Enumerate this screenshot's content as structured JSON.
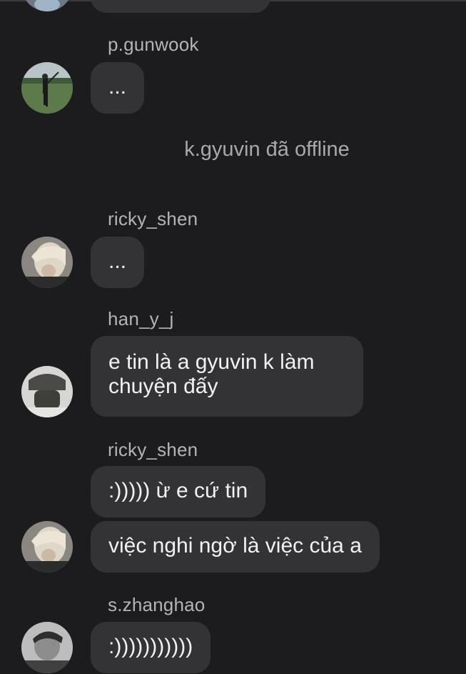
{
  "chat": {
    "system_message": "k.gyuvin đã offline",
    "messages": [
      {
        "id": "top-partial",
        "username": "",
        "text": ""
      },
      {
        "id": "gunwook",
        "username": "p.gunwook",
        "text": "..."
      },
      {
        "id": "ricky1",
        "username": "ricky_shen",
        "text": "..."
      },
      {
        "id": "hanyj",
        "username": "han_y_j",
        "text": "e tin là a gyuvin k làm chuyện đấy"
      },
      {
        "id": "ricky2",
        "username": "ricky_shen",
        "text": ":))))) ừ e cứ tin"
      },
      {
        "id": "ricky3",
        "username": "",
        "text": "việc nghi ngờ là việc của a"
      },
      {
        "id": "zhanghao",
        "username": "s.zhanghao",
        "text": ":)))))))))))"
      }
    ]
  },
  "avatars": {
    "gunwook": "avatar-golfer-photo",
    "ricky": "avatar-blond-portrait",
    "hanyj": "avatar-masked-portrait",
    "zhanghao": "avatar-bw-portrait"
  }
}
